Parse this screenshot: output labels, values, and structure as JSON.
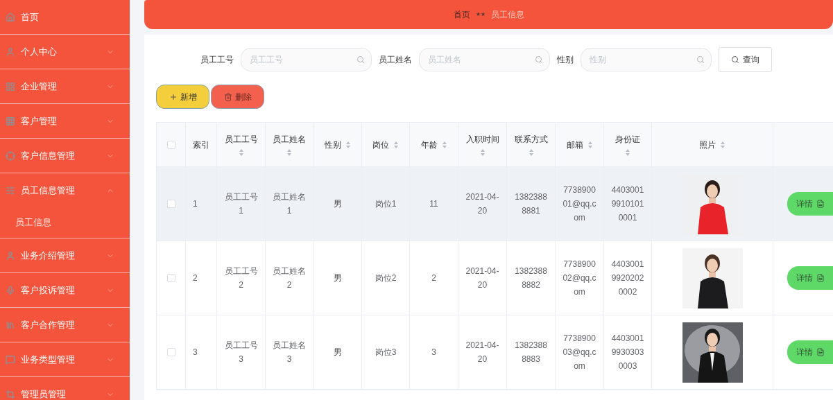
{
  "sidebar": {
    "items": [
      {
        "label": "首页",
        "kind": "link"
      },
      {
        "label": "个人中心",
        "kind": "group",
        "expanded": false
      },
      {
        "label": "企业管理",
        "kind": "group",
        "expanded": false
      },
      {
        "label": "客户管理",
        "kind": "group",
        "expanded": false
      },
      {
        "label": "客户信息管理",
        "kind": "group",
        "expanded": false
      },
      {
        "label": "员工信息管理",
        "kind": "group",
        "expanded": true,
        "children": [
          {
            "label": "员工信息"
          }
        ]
      },
      {
        "label": "业务介绍管理",
        "kind": "group",
        "expanded": false
      },
      {
        "label": "客户投诉管理",
        "kind": "group",
        "expanded": false
      },
      {
        "label": "客户合作管理",
        "kind": "group",
        "expanded": false
      },
      {
        "label": "业务类型管理",
        "kind": "group",
        "expanded": false
      },
      {
        "label": "管理员管理",
        "kind": "group",
        "expanded": false
      }
    ]
  },
  "breadcrumb": {
    "home": "首页",
    "separator": "★★",
    "current": "员工信息"
  },
  "search": {
    "fields": [
      {
        "label": "员工工号",
        "placeholder": "员工工号"
      },
      {
        "label": "员工姓名",
        "placeholder": "员工姓名"
      },
      {
        "label": "性别",
        "placeholder": "性别"
      }
    ],
    "button": "查询"
  },
  "actions": {
    "add": "新增",
    "delete": "删除"
  },
  "table": {
    "all_checked": false,
    "columns": [
      {
        "label": "索引",
        "sortable": false
      },
      {
        "label": "员工工号",
        "sortable": true
      },
      {
        "label": "员工姓名",
        "sortable": true
      },
      {
        "label": "性别",
        "sortable": true
      },
      {
        "label": "岗位",
        "sortable": true
      },
      {
        "label": "年龄",
        "sortable": true
      },
      {
        "label": "入职时间",
        "sortable": true
      },
      {
        "label": "联系方式",
        "sortable": true
      },
      {
        "label": "邮箱",
        "sortable": true
      },
      {
        "label": "身份证",
        "sortable": true
      },
      {
        "label": "照片",
        "sortable": true
      }
    ],
    "rows": [
      {
        "hovered": true,
        "checked": false,
        "cells": [
          "1",
          "员工工号1",
          "员工姓名1",
          "男",
          "岗位1",
          "11",
          "2021-04-20",
          "13823888881",
          "773890001@qq.com",
          "440300199101010001"
        ],
        "photo": {
          "kind": "picture"
        },
        "detail": "详情"
      },
      {
        "hovered": false,
        "checked": false,
        "cells": [
          "2",
          "员工工号2",
          "员工姓名2",
          "男",
          "岗位2",
          "2",
          "2021-04-20",
          "13823888882",
          "773890002@qq.com",
          "440300199202020002"
        ],
        "photo": {
          "kind": "picture"
        },
        "detail": "详情"
      },
      {
        "hovered": false,
        "checked": false,
        "cells": [
          "3",
          "员工工号3",
          "员工姓名3",
          "男",
          "岗位3",
          "3",
          "2021-04-20",
          "13823888883",
          "773890003@qq.com",
          "440300199303030003"
        ],
        "photo": {
          "kind": "picture"
        },
        "detail": "详情"
      }
    ]
  }
}
